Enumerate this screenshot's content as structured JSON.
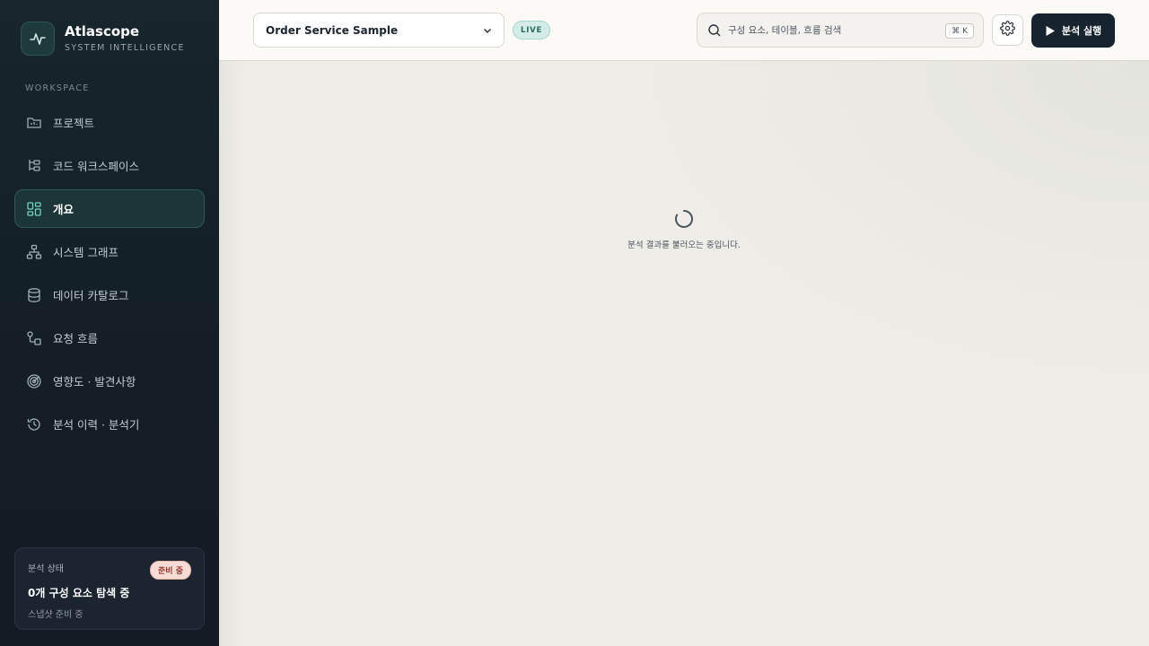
{
  "brand": {
    "name": "Atlascope",
    "subtitle": "SYSTEM INTELLIGENCE"
  },
  "sidebar": {
    "section_label": "WORKSPACE",
    "items": [
      {
        "label": "프로젝트",
        "icon": "folder-icon"
      },
      {
        "label": "코드 워크스페이스",
        "icon": "tree-icon"
      },
      {
        "label": "개요",
        "icon": "grid-icon",
        "active": true
      },
      {
        "label": "시스템 그래프",
        "icon": "graph-icon"
      },
      {
        "label": "데이터 카탈로그",
        "icon": "database-icon"
      },
      {
        "label": "요청 흐름",
        "icon": "flow-icon"
      },
      {
        "label": "영향도 · 발견사항",
        "icon": "radar-icon"
      },
      {
        "label": "분석 이력 · 분석기",
        "icon": "history-icon"
      }
    ],
    "status": {
      "title": "분석 상태",
      "badge": "준비 중",
      "main": "0개 구성 요소 탐색 중",
      "sub": "스냅샷 준비 중"
    }
  },
  "header": {
    "project": "Order Service Sample",
    "live_badge": "LIVE",
    "search_placeholder": "구성 요소, 테이블, 흐름 검색",
    "shortcut": "⌘ K",
    "run_label": "분석 실행"
  },
  "main": {
    "loading_text": "분석 결과를 불러오는 중입니다."
  },
  "colors": {
    "accent": "#2c5a55",
    "run_button": "#17232e",
    "badge_warn": "#f6dcd5"
  }
}
